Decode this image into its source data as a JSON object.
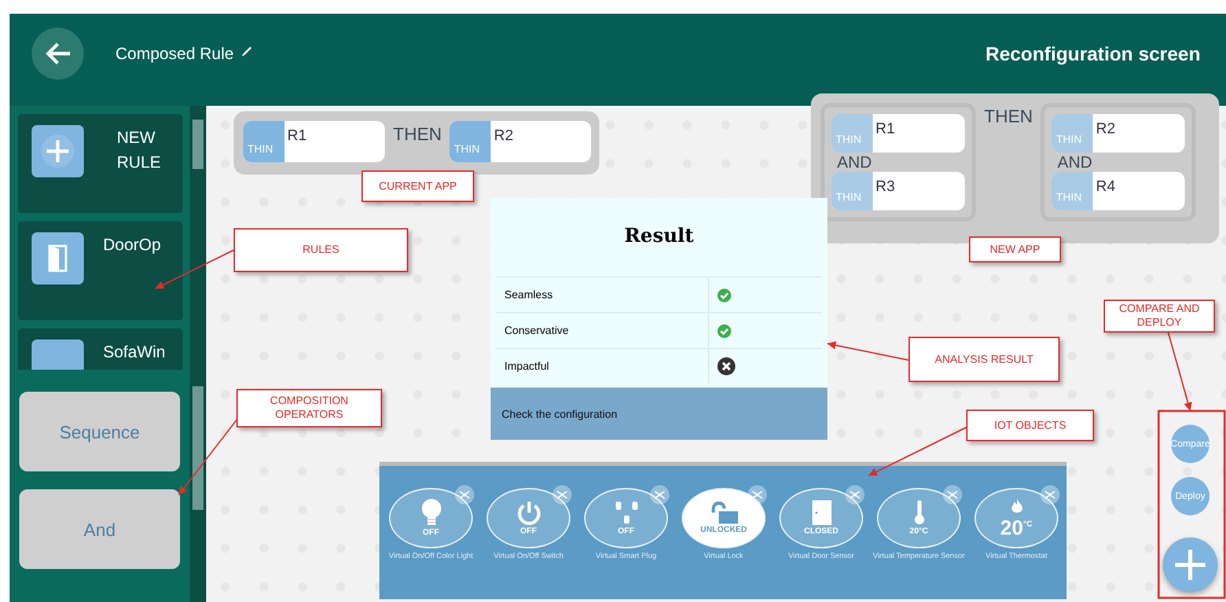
{
  "header": {
    "title": "Composed Rule",
    "screen_title": "Reconfiguration screen"
  },
  "rules": [
    {
      "label": "NEW RULE",
      "kind": "add"
    },
    {
      "label": "DoorOp",
      "kind": "door"
    },
    {
      "label": "SofaWin",
      "kind": "generic"
    }
  ],
  "operators": [
    {
      "label": "Sequence"
    },
    {
      "label": "And"
    }
  ],
  "current_app": {
    "connector": "THEN",
    "groups": [
      {
        "rules": [
          {
            "tag": "THIN",
            "name": "R1"
          }
        ]
      },
      {
        "rules": [
          {
            "tag": "THIN",
            "name": "R2"
          }
        ]
      }
    ]
  },
  "new_app": {
    "connector": "THEN",
    "groups": [
      {
        "joiner": "AND",
        "rules": [
          {
            "tag": "THIN",
            "name": "R1"
          },
          {
            "tag": "THIN",
            "name": "R3"
          }
        ]
      },
      {
        "joiner": "AND",
        "rules": [
          {
            "tag": "THIN",
            "name": "R2"
          },
          {
            "tag": "THIN",
            "name": "R4"
          }
        ]
      }
    ]
  },
  "result": {
    "title": "Result",
    "rows": [
      {
        "label": "Seamless",
        "ok": true
      },
      {
        "label": "Conservative",
        "ok": true
      },
      {
        "label": "Impactful",
        "ok": false
      }
    ],
    "footer": "Check the configuration"
  },
  "iot_objects": [
    {
      "kind": "bulb",
      "state": "OFF",
      "name": "Virtual On/Off Color Light",
      "active": false
    },
    {
      "kind": "power",
      "state": "OFF",
      "name": "Virtual On/Off Switch",
      "active": false
    },
    {
      "kind": "plug",
      "state": "OFF",
      "name": "Virtual Smart Plug",
      "active": false
    },
    {
      "kind": "lock",
      "state": "UNLOCKED",
      "name": "Virtual Lock",
      "active": true
    },
    {
      "kind": "door",
      "state": "CLOSED",
      "name": "Virtual Door Sensor",
      "active": false
    },
    {
      "kind": "thermometer",
      "state": "20°C",
      "name": "Virtual Temperature Sensor",
      "active": false
    },
    {
      "kind": "thermostat",
      "state": "20",
      "unit": "°C",
      "name": "Virtual Thermostat",
      "active": false
    }
  ],
  "actions": [
    {
      "label": "Compare"
    },
    {
      "label": "Deploy"
    }
  ],
  "annotations": [
    {
      "text": "CURRENT APP"
    },
    {
      "text": "RULES"
    },
    {
      "text": "NEW APP"
    },
    {
      "text": "COMPARE AND DEPLOY"
    },
    {
      "text": "ANALYSIS RESULT"
    },
    {
      "text": "COMPOSITION OPERATORS"
    },
    {
      "text": "IOT OBJECTS"
    }
  ]
}
